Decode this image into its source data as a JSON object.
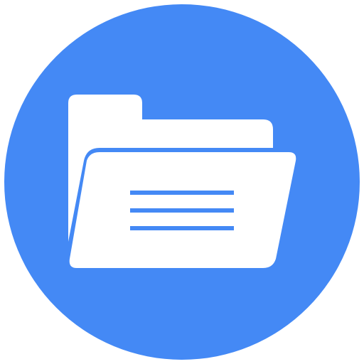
{
  "icon": {
    "name": "open-folder-icon",
    "colors": {
      "circle": "#4489F5",
      "folder": "#FFFFFF",
      "lines": "#4489F5",
      "background": "#FFFFFF"
    }
  }
}
